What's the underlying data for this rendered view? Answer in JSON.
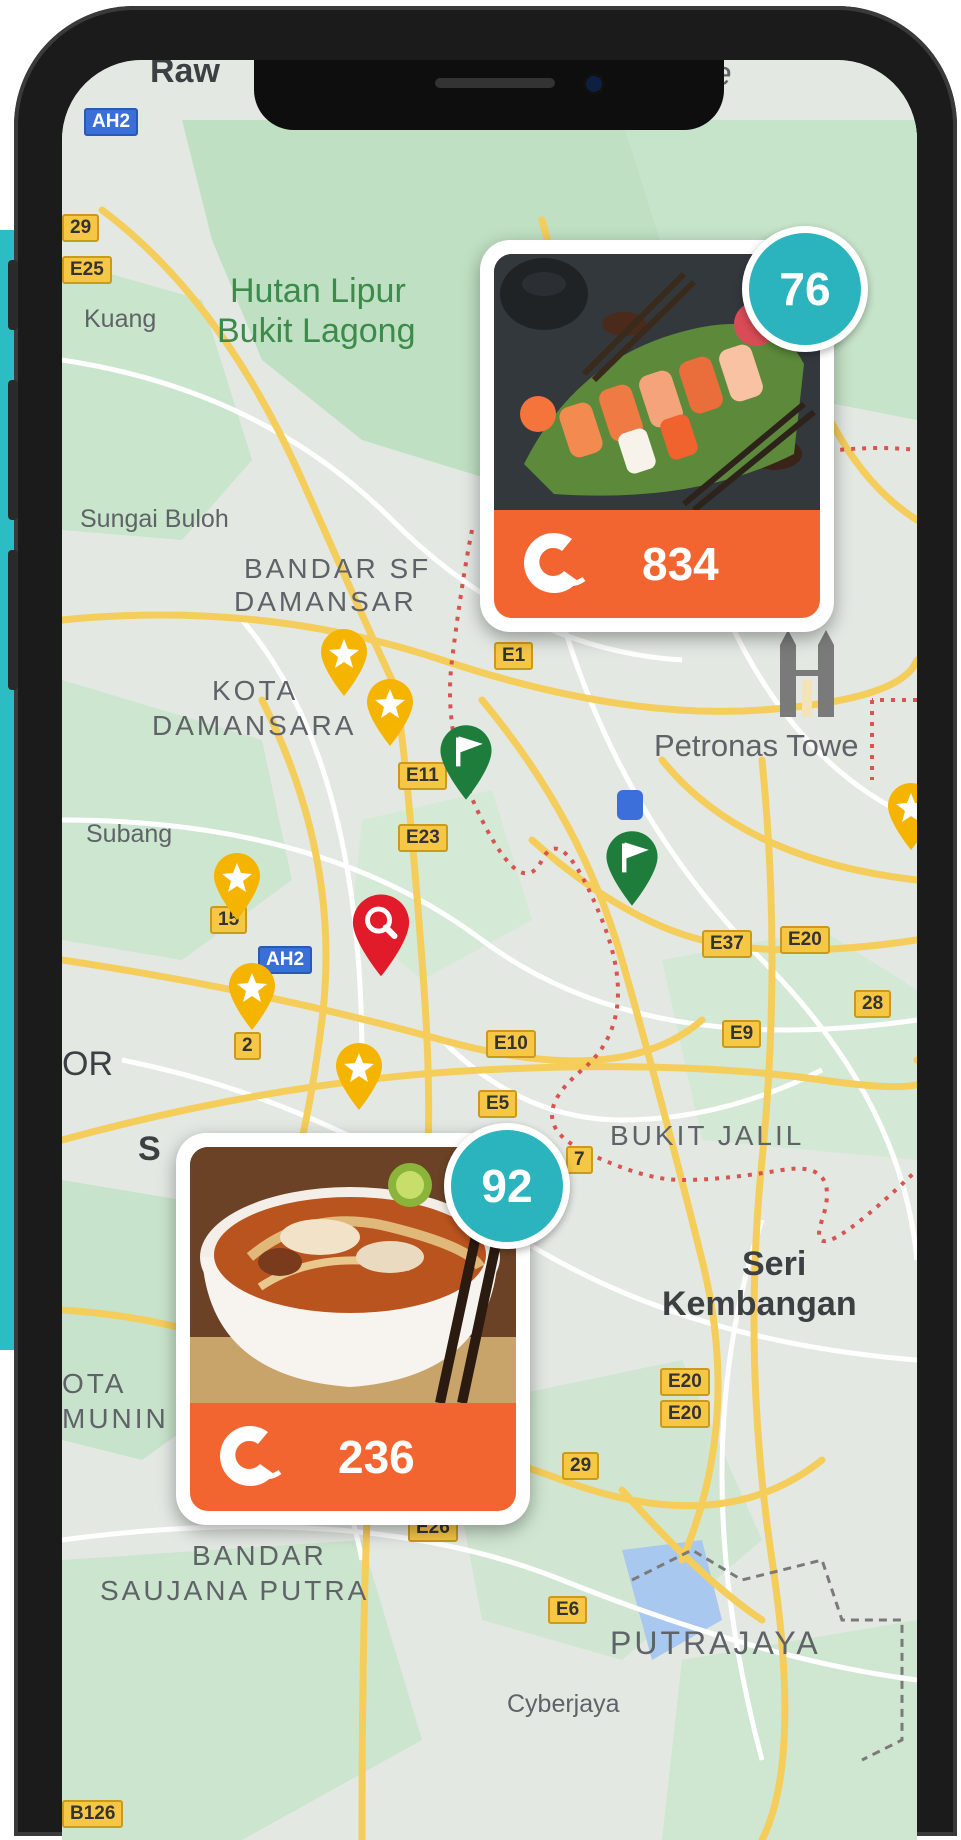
{
  "map": {
    "places": {
      "rawang": "Raw",
      "hutan_lipur": "Hutan Lipur",
      "bukit_lagong": "Bukit Lagong",
      "kuang": "Kuang",
      "sungai_buloh": "Sungai Buloh",
      "bandar_sri_1": "BANDAR SF",
      "bandar_sri_2": "DAMANSAR",
      "kota_damansara_1": "KOTA",
      "kota_damansara_2": "DAMANSARA",
      "petronas": "Petronas Towe",
      "subang": "Subang",
      "or": "OR",
      "s": "S",
      "bukit_jalil": "BUKIT JALIL",
      "seri": "Seri",
      "kembangan": "Kembangan",
      "kota_kemuning_1": "OTA",
      "kota_kemuning_2": "MUNIN",
      "bandar_saujana_1": "BANDAR",
      "bandar_saujana_2": "SAUJANA PUTRA",
      "putrajaya": "PUTRAJAYA",
      "cyberjaya": "Cyberjaya",
      "top_right": "Pe"
    },
    "road_shields": {
      "ah2_top": "AH2",
      "r29": "29",
      "e25": "E25",
      "e1": "E1",
      "e11": "E11",
      "e23": "E23",
      "r15": "15",
      "ah2_mid": "AH2",
      "r2": "2",
      "e10": "E10",
      "e5": "E5",
      "e37": "E37",
      "e20_a": "E20",
      "r28": "28",
      "e9": "E9",
      "r7": "7",
      "e20_b": "E20",
      "e20_c": "E20",
      "r29_b": "29",
      "e26": "E26",
      "e6": "E6",
      "b126": "B126"
    }
  },
  "cards": [
    {
      "id": "sushi",
      "count": "834",
      "badge": "76"
    },
    {
      "id": "laksa",
      "count": "236",
      "badge": "92"
    }
  ],
  "colors": {
    "accent_orange": "#f26531",
    "badge_teal": "#2bb4bd",
    "pin_yellow": "#f4b400",
    "pin_green": "#1e7d3a",
    "pin_red": "#e21b2a"
  }
}
